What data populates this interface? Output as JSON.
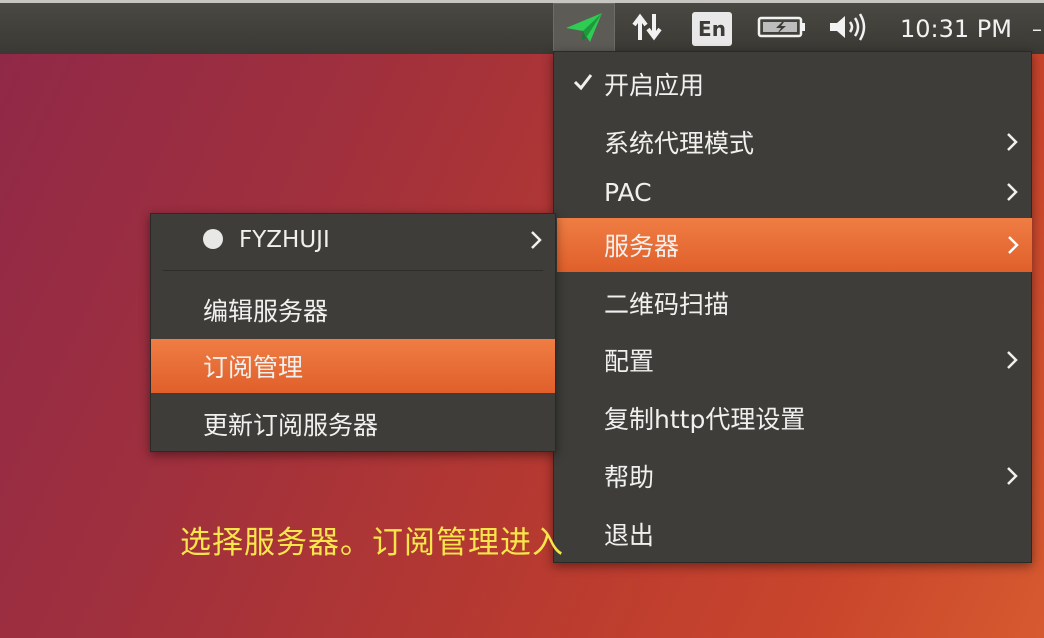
{
  "panel": {
    "icons": [
      "paper-plane-icon",
      "network-arrows-icon",
      "keyboard-layout-indicator",
      "battery-icon",
      "volume-icon"
    ],
    "keyboard_label": "En",
    "clock": "10:31 PM",
    "accent_color": "#27c24c"
  },
  "main_menu": {
    "items": [
      {
        "label": "开启应用",
        "checked": true
      },
      {
        "label": "系统代理模式",
        "submenu": true
      },
      {
        "label": "PAC",
        "submenu": true
      },
      {
        "label": "服务器",
        "submenu": true,
        "active": true
      },
      {
        "label": "二维码扫描"
      },
      {
        "label": "配置",
        "submenu": true
      },
      {
        "label": "复制http代理设置"
      },
      {
        "label": "帮助",
        "submenu": true
      },
      {
        "label": "退出"
      }
    ]
  },
  "server_menu": {
    "items": [
      {
        "label": "FYZHUJI",
        "submenu": true,
        "bullet": true
      },
      {
        "label": "编辑服务器"
      },
      {
        "label": "订阅管理",
        "active": true
      },
      {
        "label": "更新订阅服务器"
      }
    ]
  },
  "annotation": "选择服务器。订阅管理进入",
  "colors": {
    "highlight": "#e8693a",
    "menu_bg": "#3e3d39",
    "annotation_text": "#f7e64a"
  }
}
